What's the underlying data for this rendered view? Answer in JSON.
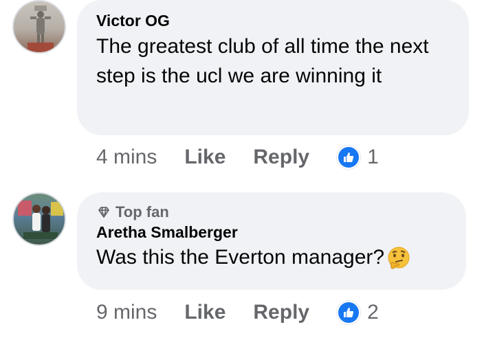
{
  "comments": [
    {
      "author": "Victor OG",
      "text": "The greatest club of all time the next step is the ucl we are winning it",
      "time": "4 mins",
      "like_label": "Like",
      "reply_label": "Reply",
      "reaction_count": "1"
    },
    {
      "badge": "Top fan",
      "author": "Aretha Smalberger",
      "text": "Was this the Everton manager?",
      "emoji": "thinking-face",
      "time": "9 mins",
      "like_label": "Like",
      "reply_label": "Reply",
      "reaction_count": "2"
    }
  ],
  "colors": {
    "bubble": "#f0f2f5",
    "secondary_text": "#65676b",
    "like_blue": "#1877f2"
  }
}
